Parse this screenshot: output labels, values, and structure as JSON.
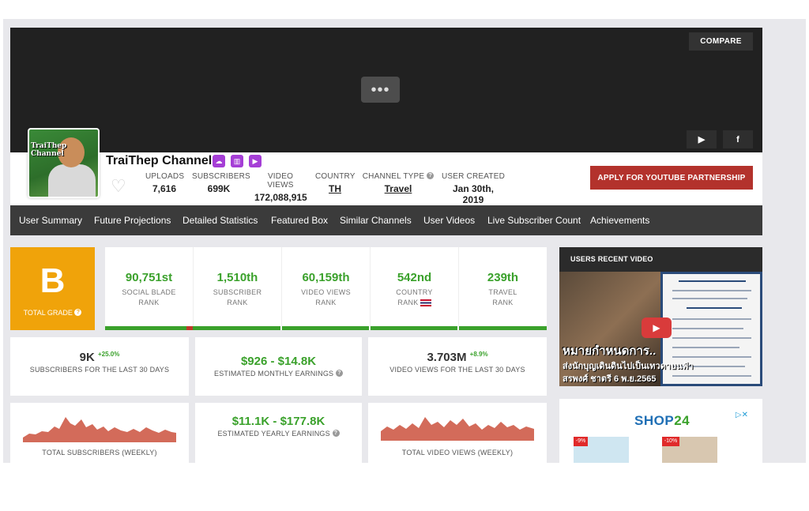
{
  "header": {
    "compare_label": "COMPARE",
    "more_label": "•••",
    "youtube_icon_label": "▶",
    "facebook_icon_label": "f"
  },
  "channel": {
    "name": "TraiThep Channel",
    "avatar_text": "TraiThep Channel",
    "stats": [
      {
        "label": "UPLOADS",
        "value": "7,616"
      },
      {
        "label": "SUBSCRIBERS",
        "value": "699K"
      },
      {
        "label": "VIDEO VIEWS",
        "value": "172,088,915"
      },
      {
        "label": "COUNTRY",
        "value": "TH"
      },
      {
        "label": "CHANNEL TYPE",
        "value": "Travel"
      },
      {
        "label": "USER CREATED",
        "value": "Jan 30th, 2019"
      }
    ],
    "apply_label": "APPLY FOR YOUTUBE PARTNERSHIP"
  },
  "nav": {
    "items": [
      "User Summary",
      "Future Projections",
      "Detailed Statistics",
      "Featured Box",
      "Similar Channels",
      "User Videos",
      "Live Subscriber Count",
      "Achievements"
    ]
  },
  "grade": {
    "letter": "B",
    "label": "TOTAL GRADE"
  },
  "ranks": [
    {
      "value": "90,751st",
      "label1": "SOCIAL BLADE",
      "label2": "RANK",
      "bar_fill": 0.97
    },
    {
      "value": "1,510th",
      "label1": "SUBSCRIBER",
      "label2": "RANK",
      "bar_fill": 1.0
    },
    {
      "value": "60,159th",
      "label1": "VIDEO VIEWS",
      "label2": "RANK",
      "bar_fill": 1.0
    },
    {
      "value": "542nd",
      "label1": "COUNTRY",
      "label2": "RANK",
      "bar_fill": 1.0
    },
    {
      "value": "239th",
      "label1": "TRAVEL",
      "label2": "RANK",
      "bar_fill": 1.0
    }
  ],
  "metrics": {
    "subs30": {
      "value": "9K",
      "pct": "+25.0%",
      "label": "SUBSCRIBERS FOR THE LAST 30 DAYS"
    },
    "monthly": {
      "value": "$926  -  $14.8K",
      "label": "ESTIMATED MONTHLY EARNINGS"
    },
    "views30": {
      "value": "3.703M",
      "pct": "+8.9%",
      "label": "VIDEO VIEWS FOR THE LAST 30 DAYS"
    },
    "total_subs_label": "TOTAL SUBSCRIBERS (WEEKLY)",
    "yearly": {
      "value": "$11.1K  -  $177.8K",
      "label": "ESTIMATED YEARLY EARNINGS"
    },
    "total_views_label": "TOTAL VIDEO VIEWS (WEEKLY)"
  },
  "recent_video": {
    "heading": "USERS RECENT VIDEO",
    "title_line": "หมายกำหนดการ..",
    "sub_line": "ส่งนักบุญเดินดินไปเป็นเทวดาบนฟ้า",
    "date_line": "สรพงศ์ ชาตรี 6 พ.ย.2565"
  },
  "ad": {
    "logo_a": "SHOP",
    "logo_b": "24",
    "discount_1": "-9%",
    "discount_2": "-10%"
  },
  "colors": {
    "green": "#3aa12b",
    "orange": "#f0a30a",
    "red": "#b3322c",
    "nav": "#3b3b3b",
    "badge": "#a53ed6"
  }
}
